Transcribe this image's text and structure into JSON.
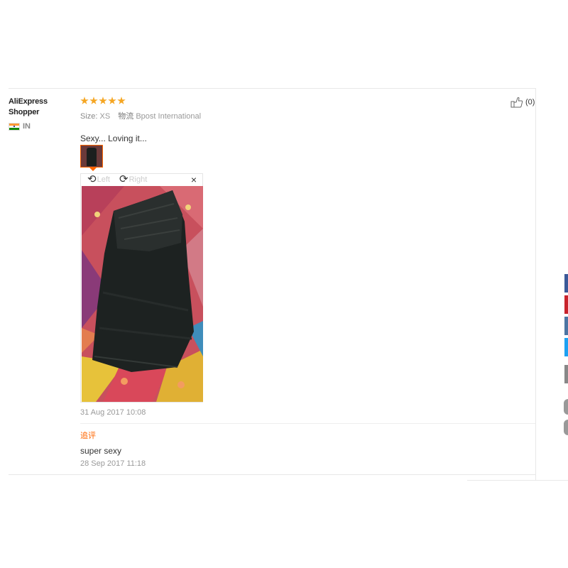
{
  "review": {
    "user": {
      "name": "AliExpress Shopper",
      "country": "IN",
      "flag_icon": "india-flag-icon"
    },
    "rating": {
      "stars": 5,
      "max": 5,
      "color": "#f5a623"
    },
    "meta": {
      "size_label": "Size:",
      "size_value": "XS",
      "logistics_label": "物流",
      "logistics_value": "Bpost International"
    },
    "text": "Sexy... Loving it...",
    "viewer": {
      "rotate_left": "Left",
      "rotate_right": "Right",
      "close": "×"
    },
    "date": "31 Aug 2017 10:08",
    "followup": {
      "label": "追评",
      "text": "super sexy",
      "date": "28 Sep 2017 11:18"
    },
    "helpful": {
      "count": "(0)",
      "icon": "thumbs-up-icon"
    }
  },
  "colors": {
    "accent": "#ff6600",
    "star": "#f5a623",
    "facebook": "#3b5998",
    "pinterest": "#c8232c",
    "vk": "#4c75a3",
    "twitter": "#1da1f2"
  }
}
